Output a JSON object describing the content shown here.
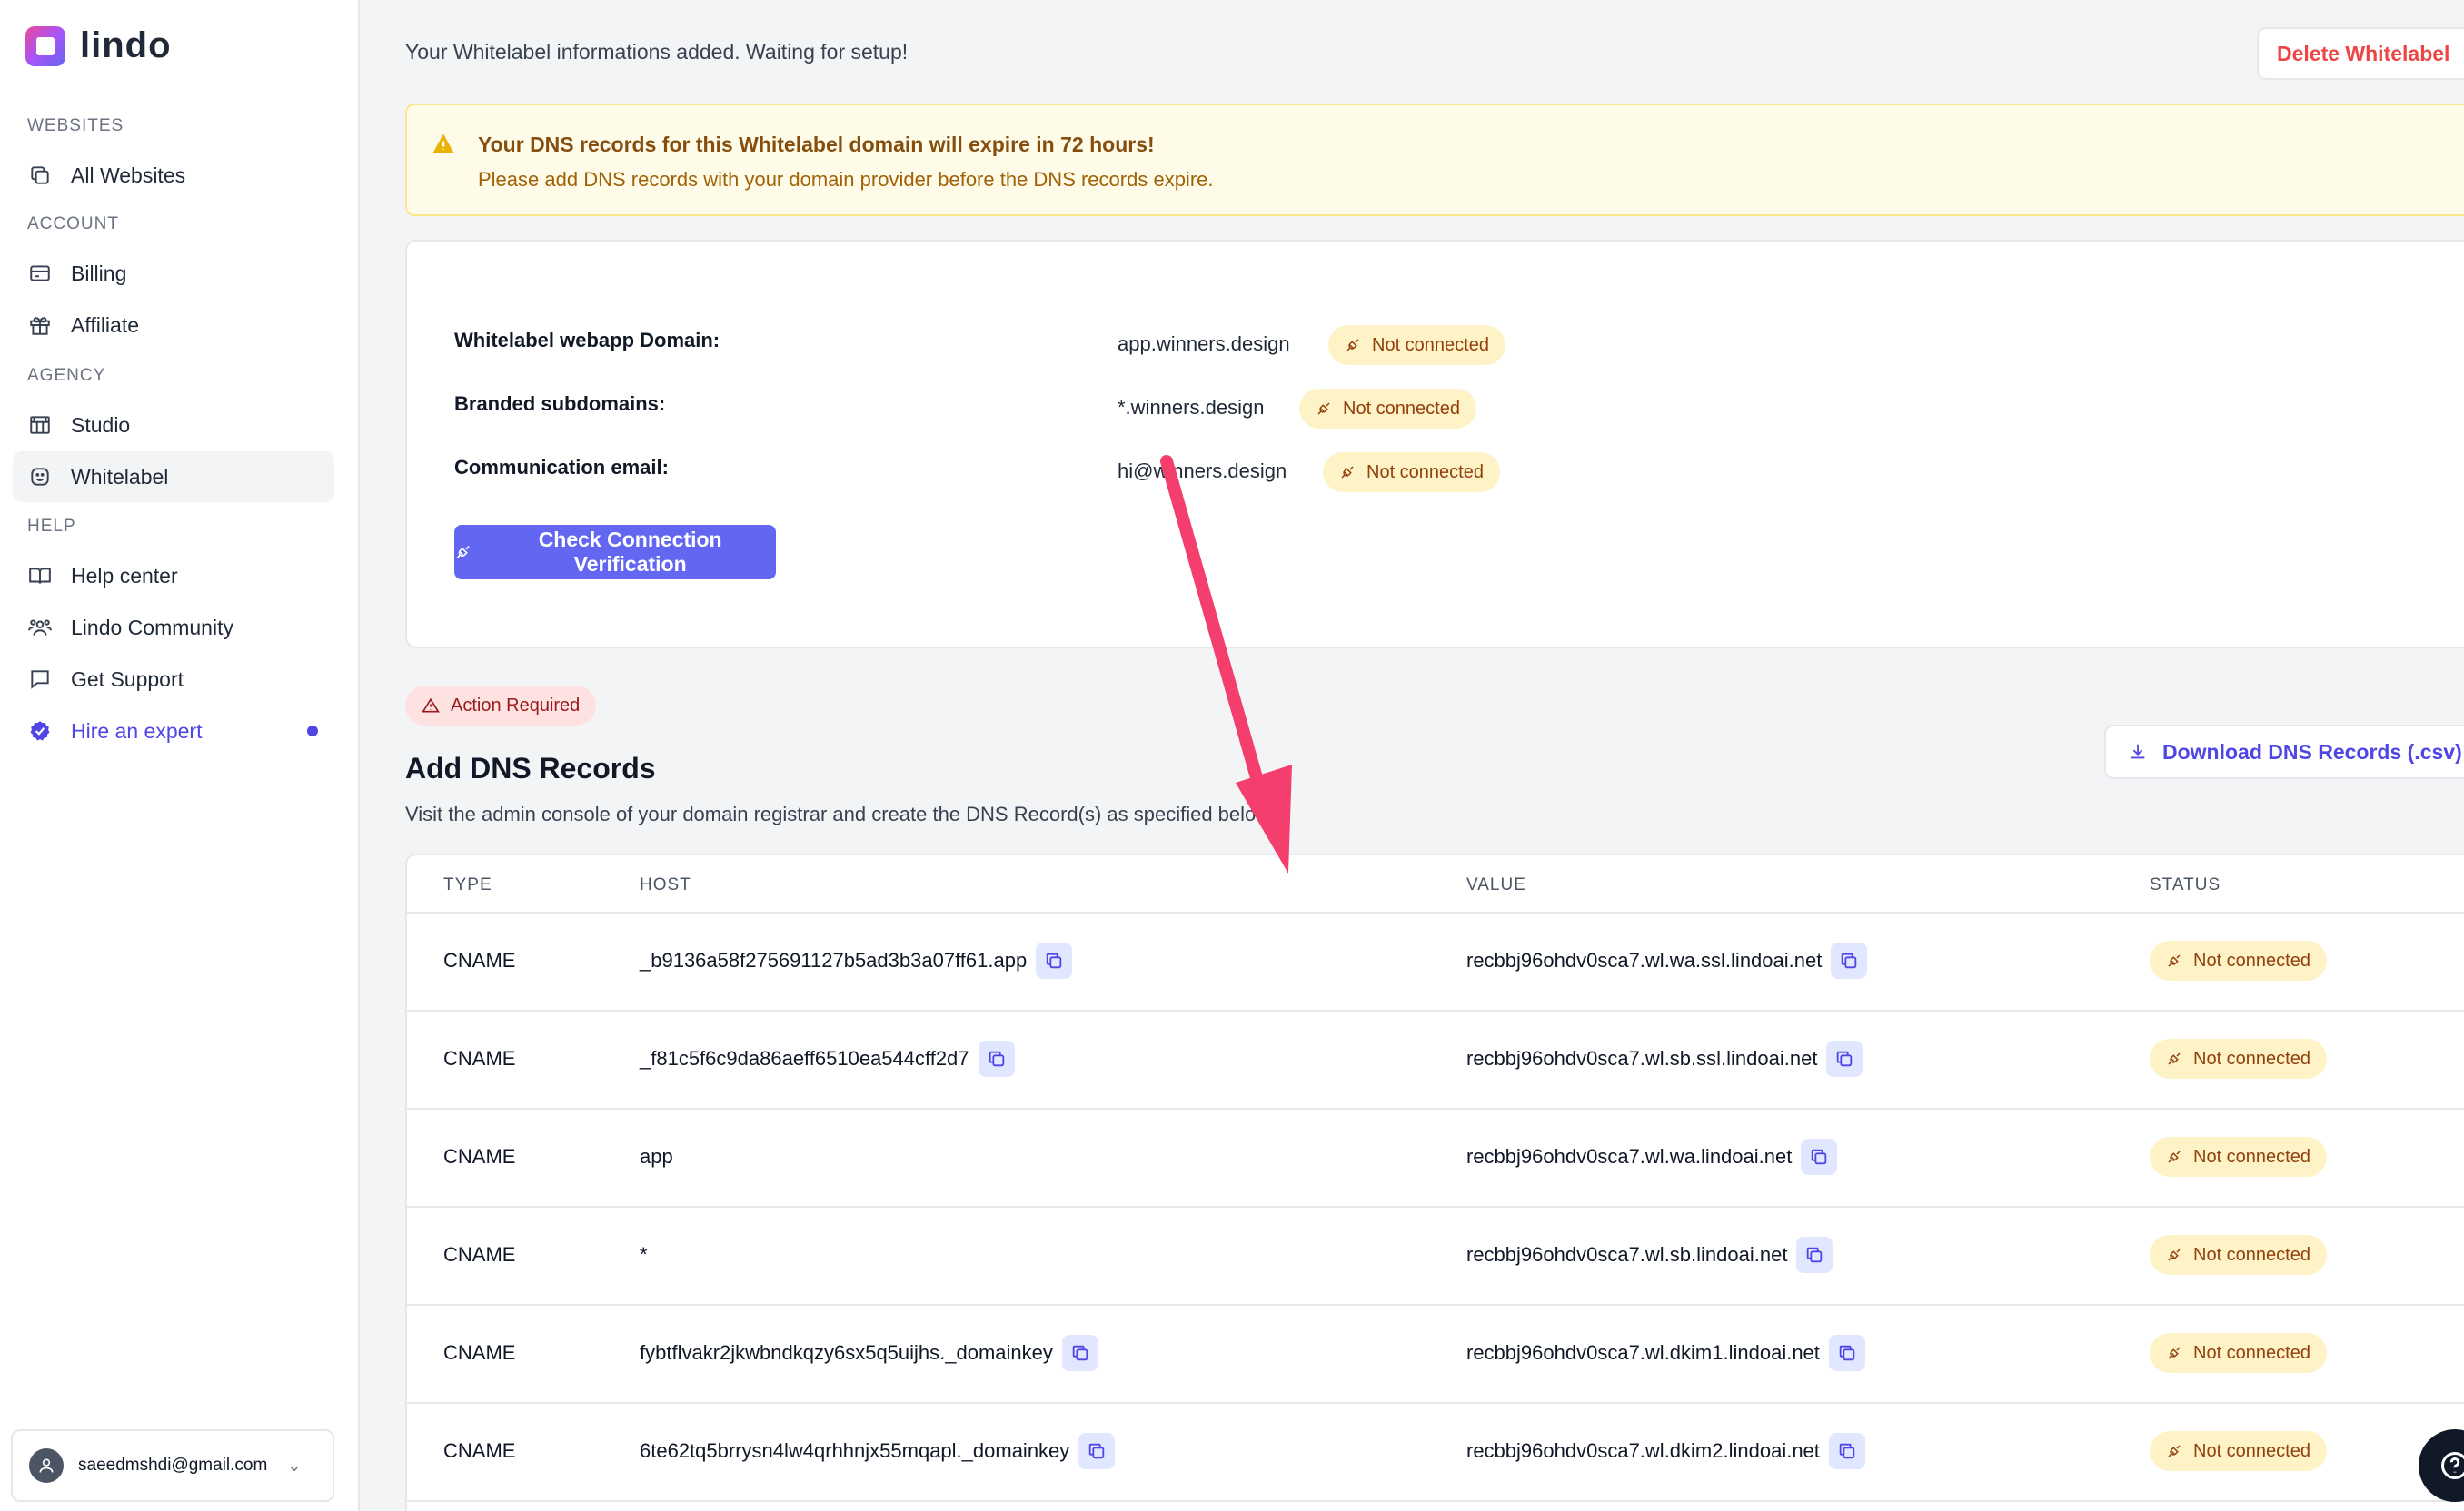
{
  "brand": {
    "name": "lindo"
  },
  "sidebar": {
    "sections": [
      {
        "label": "WEBSITES"
      },
      {
        "label": "ACCOUNT"
      },
      {
        "label": "AGENCY"
      },
      {
        "label": "HELP"
      }
    ],
    "items": [
      {
        "label": "All Websites",
        "icon": "copy-icon"
      },
      {
        "label": "Billing",
        "icon": "credit-card-icon"
      },
      {
        "label": "Affiliate",
        "icon": "gift-icon"
      },
      {
        "label": "Studio",
        "icon": "studio-icon"
      },
      {
        "label": "Whitelabel",
        "icon": "smiley-icon"
      },
      {
        "label": "Help center",
        "icon": "book-icon"
      },
      {
        "label": "Lindo Community",
        "icon": "people-icon"
      },
      {
        "label": "Get Support",
        "icon": "chat-icon"
      },
      {
        "label": "Hire an expert",
        "icon": "verified-badge-icon"
      }
    ],
    "user_email": "saeedmshdi@gmail.com"
  },
  "header": {
    "status_message": "Your Whitelabel informations added. Waiting for setup!",
    "delete_label": "Delete Whitelabel"
  },
  "alert": {
    "title": "Your DNS records for this Whitelabel domain will expire in 72 hours!",
    "body": "Please add DNS records with your domain provider before the DNS records expire."
  },
  "domains": {
    "rows": [
      {
        "label": "Whitelabel webapp Domain:",
        "value": "app.winners.design",
        "status": "Not connected"
      },
      {
        "label": "Branded subdomains:",
        "value": "*.winners.design",
        "status": "Not connected"
      },
      {
        "label": "Communication email:",
        "value": "hi@winners.design",
        "status": "Not connected"
      }
    ],
    "verify_label": "Check Connection Verification"
  },
  "dns": {
    "action_badge": "Action Required",
    "title": "Add DNS Records",
    "subtitle": "Visit the admin console of your domain registrar and create the DNS Record(s) as specified below.",
    "download_label": "Download DNS Records (.csv)",
    "columns": [
      "TYPE",
      "HOST",
      "VALUE",
      "STATUS"
    ],
    "records": [
      {
        "type": "CNAME",
        "host": "_b9136a58f275691127b5ad3b3a07ff61.app",
        "value": "recbbj96ohdv0sca7.wl.wa.ssl.lindoai.net",
        "status": "Not connected",
        "host_copy": true
      },
      {
        "type": "CNAME",
        "host": "_f81c5f6c9da86aeff6510ea544cff2d7",
        "value": "recbbj96ohdv0sca7.wl.sb.ssl.lindoai.net",
        "status": "Not connected",
        "host_copy": true
      },
      {
        "type": "CNAME",
        "host": "app",
        "value": "recbbj96ohdv0sca7.wl.wa.lindoai.net",
        "status": "Not connected",
        "host_copy": false
      },
      {
        "type": "CNAME",
        "host": "*",
        "value": "recbbj96ohdv0sca7.wl.sb.lindoai.net",
        "status": "Not connected",
        "host_copy": false
      },
      {
        "type": "CNAME",
        "host": "fybtflvakr2jkwbndkqzy6sx5q5uijhs._domainkey",
        "value": "recbbj96ohdv0sca7.wl.dkim1.lindoai.net",
        "status": "Not connected",
        "host_copy": true
      },
      {
        "type": "CNAME",
        "host": "6te62tq5brrysn4lw4qrhhnjx55mqapl._domainkey",
        "value": "recbbj96ohdv0sca7.wl.dkim2.lindoai.net",
        "status": "Not connected",
        "host_copy": true
      }
    ]
  },
  "colors": {
    "accent": "#6366f1",
    "danger": "#ef4444",
    "warning_bg": "#fefce8",
    "badge_bg": "#fef3c7",
    "annotation_arrow": "#f43f6e"
  }
}
